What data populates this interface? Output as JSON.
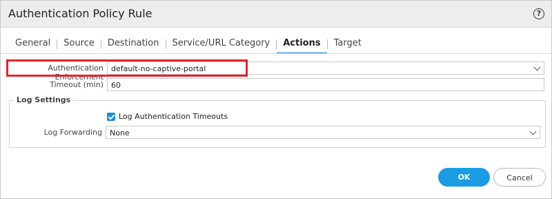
{
  "dialog": {
    "title": "Authentication Policy Rule",
    "help_glyph": "?"
  },
  "tabs": [
    {
      "label": "General"
    },
    {
      "label": "Source"
    },
    {
      "label": "Destination"
    },
    {
      "label": "Service/URL Category"
    },
    {
      "label": "Actions",
      "active": true
    },
    {
      "label": "Target"
    }
  ],
  "actions": {
    "auth_enforcement_label": "Authentication Enforcement",
    "auth_enforcement_value": "default-no-captive-portal",
    "timeout_label": "Timeout (min)",
    "timeout_value": "60"
  },
  "log_settings": {
    "legend": "Log Settings",
    "log_auth_timeouts_label": "Log Authentication Timeouts",
    "log_auth_timeouts_checked": true,
    "log_forwarding_label": "Log Forwarding",
    "log_forwarding_value": "None"
  },
  "buttons": {
    "ok": "OK",
    "cancel": "Cancel"
  },
  "colors": {
    "accent": "#1a9be4",
    "highlight": "#e4232c"
  }
}
